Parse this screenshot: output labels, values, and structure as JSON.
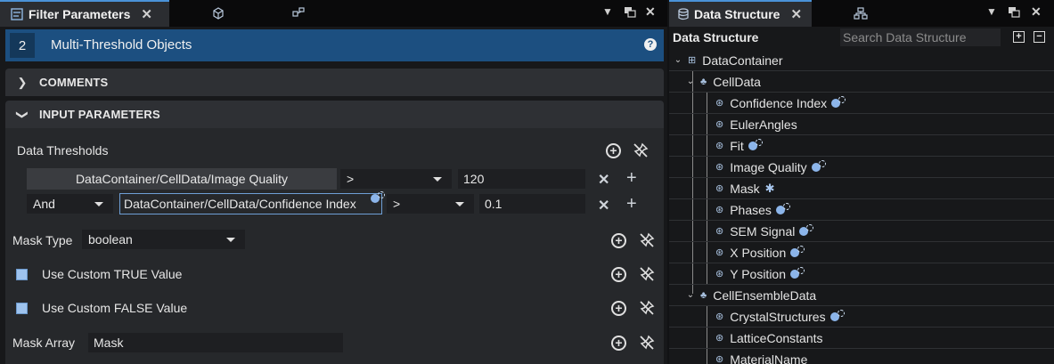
{
  "left_panel": {
    "tab_title": "Filter Parameters",
    "tab_close": "✕",
    "filter_index": "2",
    "filter_name": "Multi-Threshold Objects",
    "help": "?",
    "sections": {
      "comments": "COMMENTS",
      "input": "INPUT PARAMETERS"
    },
    "data_thresholds": {
      "label": "Data Thresholds",
      "rows": [
        {
          "array": "DataContainer/CellData/Image Quality",
          "operator": ">",
          "value": "120"
        },
        {
          "logic": "And",
          "array": "DataContainer/CellData/Confidence Index",
          "operator": ">",
          "value": "0.1"
        }
      ]
    },
    "mask_type": {
      "label": "Mask Type",
      "value": "boolean"
    },
    "custom_true": {
      "label": "Use Custom TRUE Value"
    },
    "custom_false": {
      "label": "Use Custom FALSE Value"
    },
    "mask_array": {
      "label": "Mask Array",
      "value": "Mask"
    }
  },
  "right_panel": {
    "tab_title": "Data Structure",
    "tab_close": "✕",
    "title": "Data Structure",
    "search_placeholder": "Search Data Structure",
    "tree": {
      "container": "DataContainer",
      "cell_data": "CellData",
      "cell_arrays": [
        "Confidence Index",
        "EulerAngles",
        "Fit",
        "Image Quality",
        "Mask",
        "Phases",
        "SEM Signal",
        "X Position",
        "Y Position"
      ],
      "ensemble": "CellEnsembleData",
      "ensemble_arrays": [
        "CrystalStructures",
        "LatticeConstants",
        "MaterialName"
      ]
    }
  },
  "colors": {
    "accent": "#4a92d8",
    "filter_bar": "#1c4f80",
    "checkbox": "#9ec3ee"
  }
}
